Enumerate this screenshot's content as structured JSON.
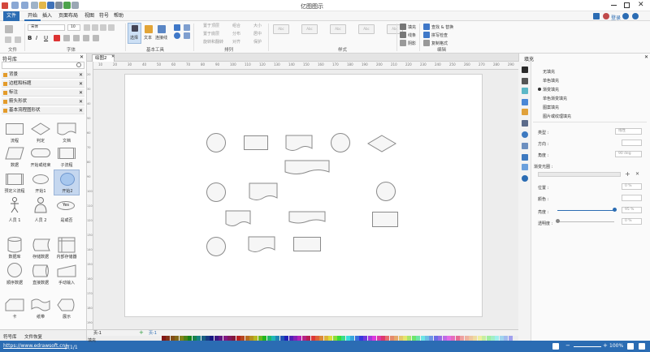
{
  "app": {
    "title": "亿图图示"
  },
  "menubar": {
    "items": [
      "文件",
      "开始",
      "插入",
      "页面布局",
      "视图",
      "符号",
      "帮助"
    ],
    "right": {
      "login": "登录"
    }
  },
  "ribbon": {
    "font_name": "宋体",
    "font_size": "10",
    "select_label": "选择",
    "text_label": "文本",
    "connector_label": "连接线",
    "arrange": {
      "front": "置于顶层",
      "back": "置于底层",
      "rotate": "旋转和翻转",
      "group": "组合",
      "distribute": "分布",
      "align": "对齐",
      "size": "大小",
      "center": "居中",
      "protect": "保护"
    },
    "style_sample": "Abc",
    "fill": "填充",
    "line": "线条",
    "shadow": "阴影",
    "find_replace": "查找 & 替换",
    "spell": "拼写检查",
    "clone": "复制格式",
    "groups": {
      "file": "文件",
      "font": "字体",
      "basic_tools": "基本工具",
      "arrange": "排列",
      "styles": "样式",
      "edit": "编辑"
    }
  },
  "left": {
    "title": "符号库",
    "categories": [
      "背景",
      "边框和标题",
      "标注",
      "箭头形状",
      "基本流程图形状"
    ],
    "shapes": [
      {
        "label": "流程"
      },
      {
        "label": "判定"
      },
      {
        "label": "文档"
      },
      {
        "label": "数据"
      },
      {
        "label": "开始或结束"
      },
      {
        "label": "子流程"
      },
      {
        "label": "预定义流程"
      },
      {
        "label": "开始1"
      },
      {
        "label": "开始2"
      },
      {
        "label": "人员 1"
      },
      {
        "label": "人员 2"
      },
      {
        "label": "是或否"
      },
      {
        "label": "数据库"
      },
      {
        "label": "存储数据"
      },
      {
        "label": "内部存储器"
      },
      {
        "label": "顺序数据"
      },
      {
        "label": "直接数据"
      },
      {
        "label": "手动输入"
      },
      {
        "label": "卡"
      },
      {
        "label": "纸带"
      },
      {
        "label": "展示"
      }
    ],
    "yes_text": "Yes",
    "bottom_tabs": [
      "符号库",
      "文件恢复"
    ]
  },
  "canvas": {
    "tab": "绘图2",
    "page_tab": "页-1",
    "page_tab2": "页-1"
  },
  "ruler": {
    "h": [
      "10",
      "20",
      "30",
      "40",
      "50",
      "60",
      "70",
      "80",
      "90",
      "100",
      "110",
      "120",
      "130",
      "140",
      "150",
      "160",
      "170",
      "180",
      "190",
      "200",
      "210",
      "220",
      "230",
      "240",
      "250",
      "260",
      "270",
      "280",
      "290"
    ],
    "v": [
      "20",
      "30",
      "40",
      "50",
      "60",
      "70",
      "80",
      "90",
      "100",
      "110",
      "120",
      "130",
      "140",
      "150",
      "160",
      "170",
      "180",
      "190"
    ]
  },
  "right": {
    "title": "填充",
    "options": [
      "无填充",
      "单色填充",
      "渐变填充",
      "单色渐变填充",
      "图案填充",
      "图片或纹理填充"
    ],
    "type_label": "类型 :",
    "type_value": "线性",
    "dir_label": "方向 :",
    "angle_label": "角度 :",
    "angle_value": "90 deg",
    "stops_label": "渐变光圈 :",
    "pos_label": "位置 :",
    "pos_value": "0 %",
    "color_label": "颜色 :",
    "bright_label": "亮度 :",
    "bright_value": "95 %",
    "trans_label": "透明度 :",
    "trans_value": "0 %"
  },
  "status": {
    "url": "https://www.edrawsoft.cn/",
    "page": "页1/1",
    "zoom": "100%",
    "fill_label": "填充"
  },
  "colors": {
    "accent": "#2b6cb3"
  }
}
